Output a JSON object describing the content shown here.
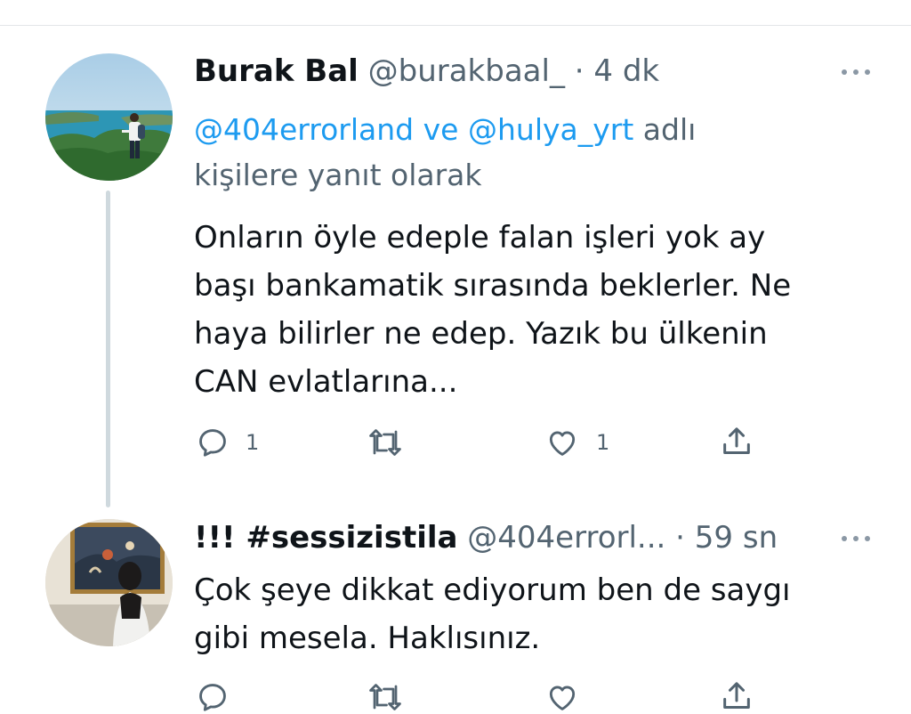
{
  "tweets": [
    {
      "display_name": "Burak Bal",
      "handle": "@burakbaal_",
      "separator": "·",
      "time": "4 dk",
      "reply_mentions": [
        "@404errorland",
        "@hulya_yrt"
      ],
      "reply_joiner": "ve",
      "reply_suffix_1": "adlı",
      "reply_suffix_2": "kişilere yanıt olarak",
      "text_lines": [
        "Onların öyle edeple falan işleri yok ay",
        "başı bankamatik sırasında beklerler. Ne",
        "haya bilirler ne edep. Yazık bu ülkenin",
        "CAN evlatlarına..."
      ],
      "reply_count": "1",
      "like_count": "1"
    },
    {
      "display_name": "!!! #sessizistila",
      "handle": "@404errorl...",
      "separator": "·",
      "time": "59 sn",
      "text_lines": [
        "Çok şeye dikkat ediyorum ben de saygı",
        "gibi mesela. Haklısınız."
      ]
    }
  ],
  "icons": {
    "reply": "reply-icon",
    "retweet": "retweet-icon",
    "like": "like-icon",
    "share": "share-icon",
    "more": "more-icon"
  },
  "colors": {
    "text": "#0f1419",
    "secondary": "#536471",
    "mention": "#1d9bf0",
    "thread_line": "#cfd9de"
  }
}
